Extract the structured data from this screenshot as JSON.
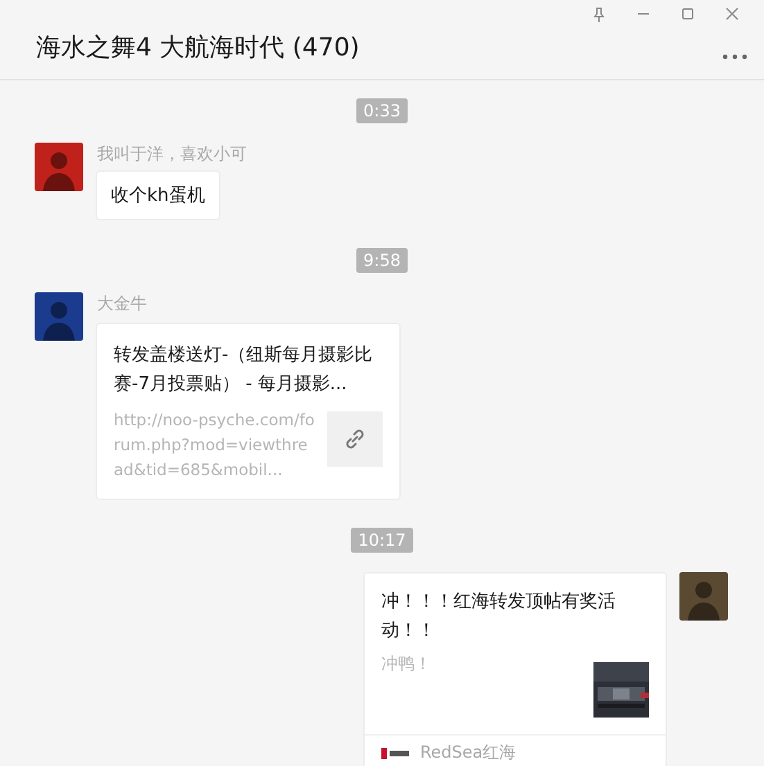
{
  "window": {
    "title": "海水之舞4 大航海时代 (470)"
  },
  "messages": [
    {
      "kind": "time",
      "text": "0:33"
    },
    {
      "kind": "text",
      "outgoing": false,
      "sender": "我叫于洋，喜欢小可",
      "text": "收个kh蛋机"
    },
    {
      "kind": "time",
      "text": "9:58"
    },
    {
      "kind": "link",
      "outgoing": false,
      "sender": "大金牛",
      "title": "转发盖楼送灯-（纽斯每月摄影比赛-7月投票贴） - 每月摄影...",
      "description": "http://noo-psyche.com/forum.php?mod=viewthread&tid=685&mobil..."
    },
    {
      "kind": "time",
      "text": "10:17"
    },
    {
      "kind": "article",
      "outgoing": true,
      "title": "冲！！！红海转发顶帖有奖活动！！",
      "description": "冲鸭！",
      "source": "RedSea红海"
    }
  ]
}
